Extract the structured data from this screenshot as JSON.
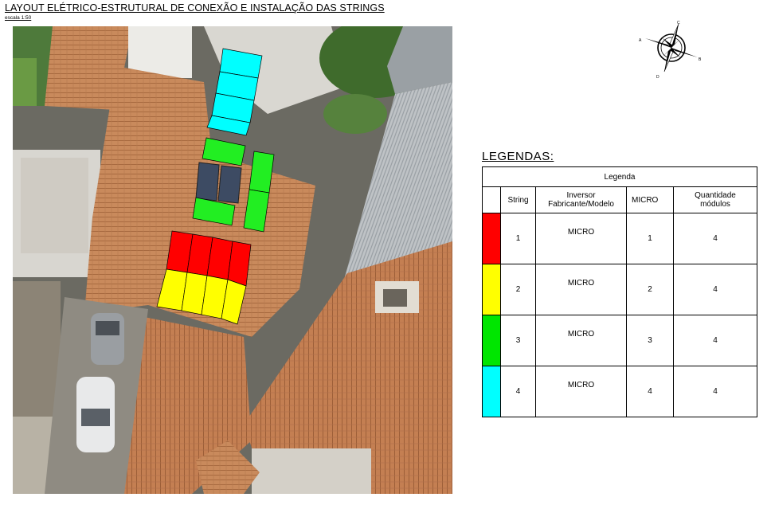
{
  "page": {
    "title": "LAYOUT ELÉTRICO-ESTRUTURAL DE CONEXÃO E INSTALAÇÃO DAS STRINGS",
    "scale": "escala 1:50"
  },
  "compass": {
    "labels": [
      "C",
      "A",
      "B",
      "D"
    ]
  },
  "legend": {
    "heading": "LEGENDAS:",
    "caption": "Legenda",
    "headers": {
      "string": "String",
      "inverter_line1": "Inversor",
      "inverter_line2": "Fabricante/Modelo",
      "micro": "MICRO",
      "qty_line1": "Quantidade",
      "qty_line2": "módulos"
    },
    "rows": [
      {
        "color": "#ff0000",
        "string": "1",
        "inverter": "MICRO",
        "micro": "1",
        "qty": "4"
      },
      {
        "color": "#ffff00",
        "string": "2",
        "inverter": "MICRO",
        "micro": "2",
        "qty": "4"
      },
      {
        "color": "#00e600",
        "string": "3",
        "inverter": "MICRO",
        "micro": "3",
        "qty": "4"
      },
      {
        "color": "#00ffff",
        "string": "4",
        "inverter": "MICRO",
        "micro": "4",
        "qty": "4"
      }
    ]
  }
}
